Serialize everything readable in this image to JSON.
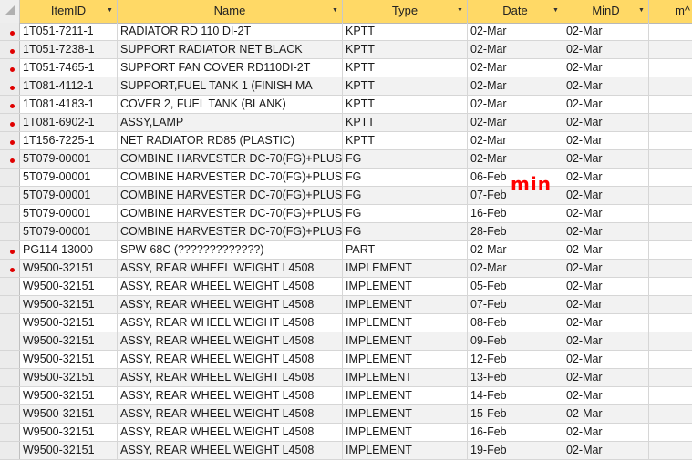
{
  "headers": {
    "item_id": "ItemID",
    "name": "Name",
    "type": "Type",
    "date": "Date",
    "mind": "MinD",
    "extra": "m^"
  },
  "annotation": "min",
  "accent_colors": {
    "header": "#ffd966",
    "dot": "#e00000",
    "annotation": "#ff0000"
  },
  "rows": [
    {
      "dot": true,
      "item_id": "1T051-7211-1",
      "name": "RADIATOR RD 110 DI-2T",
      "type": "KPTT",
      "date": "02-Mar",
      "mind": "02-Mar"
    },
    {
      "dot": true,
      "item_id": "1T051-7238-1",
      "name": "SUPPORT RADIATOR NET BLACK",
      "type": "KPTT",
      "date": "02-Mar",
      "mind": "02-Mar"
    },
    {
      "dot": true,
      "item_id": "1T051-7465-1",
      "name": "SUPPORT FAN COVER RD110DI-2T",
      "type": "KPTT",
      "date": "02-Mar",
      "mind": "02-Mar"
    },
    {
      "dot": true,
      "item_id": "1T081-4112-1",
      "name": "SUPPORT,FUEL TANK 1 (FINISH MA",
      "type": "KPTT",
      "date": "02-Mar",
      "mind": "02-Mar"
    },
    {
      "dot": true,
      "item_id": "1T081-4183-1",
      "name": "COVER 2, FUEL TANK (BLANK)",
      "type": "KPTT",
      "date": "02-Mar",
      "mind": "02-Mar"
    },
    {
      "dot": true,
      "item_id": "1T081-6902-1",
      "name": "ASSY,LAMP",
      "type": "KPTT",
      "date": "02-Mar",
      "mind": "02-Mar"
    },
    {
      "dot": true,
      "item_id": "1T156-7225-1",
      "name": "NET RADIATOR RD85 (PLASTIC)",
      "type": "KPTT",
      "date": "02-Mar",
      "mind": "02-Mar"
    },
    {
      "dot": true,
      "item_id": "5T079-00001",
      "name": "COMBINE HARVESTER DC-70(FG)+PLUS",
      "type": "FG",
      "date": "02-Mar",
      "mind": "02-Mar"
    },
    {
      "dot": false,
      "item_id": "5T079-00001",
      "name": "COMBINE HARVESTER DC-70(FG)+PLUS",
      "type": "FG",
      "date": "06-Feb",
      "mind": "02-Mar"
    },
    {
      "dot": false,
      "item_id": "5T079-00001",
      "name": "COMBINE HARVESTER DC-70(FG)+PLUS",
      "type": "FG",
      "date": "07-Feb",
      "mind": "02-Mar"
    },
    {
      "dot": false,
      "item_id": "5T079-00001",
      "name": "COMBINE HARVESTER DC-70(FG)+PLUS",
      "type": "FG",
      "date": "16-Feb",
      "mind": "02-Mar"
    },
    {
      "dot": false,
      "item_id": "5T079-00001",
      "name": "COMBINE HARVESTER DC-70(FG)+PLUS",
      "type": "FG",
      "date": "28-Feb",
      "mind": "02-Mar"
    },
    {
      "dot": true,
      "item_id": "PG114-13000",
      "name": "SPW-68C (?????????????)",
      "type": "PART",
      "date": "02-Mar",
      "mind": "02-Mar"
    },
    {
      "dot": true,
      "item_id": "W9500-32151",
      "name": "ASSY, REAR WHEEL WEIGHT L4508",
      "type": "IMPLEMENT",
      "date": "02-Mar",
      "mind": "02-Mar"
    },
    {
      "dot": false,
      "item_id": "W9500-32151",
      "name": "ASSY, REAR WHEEL WEIGHT L4508",
      "type": "IMPLEMENT",
      "date": "05-Feb",
      "mind": "02-Mar"
    },
    {
      "dot": false,
      "item_id": "W9500-32151",
      "name": "ASSY, REAR WHEEL WEIGHT L4508",
      "type": "IMPLEMENT",
      "date": "07-Feb",
      "mind": "02-Mar"
    },
    {
      "dot": false,
      "item_id": "W9500-32151",
      "name": "ASSY, REAR WHEEL WEIGHT L4508",
      "type": "IMPLEMENT",
      "date": "08-Feb",
      "mind": "02-Mar"
    },
    {
      "dot": false,
      "item_id": "W9500-32151",
      "name": "ASSY, REAR WHEEL WEIGHT L4508",
      "type": "IMPLEMENT",
      "date": "09-Feb",
      "mind": "02-Mar"
    },
    {
      "dot": false,
      "item_id": "W9500-32151",
      "name": "ASSY, REAR WHEEL WEIGHT L4508",
      "type": "IMPLEMENT",
      "date": "12-Feb",
      "mind": "02-Mar"
    },
    {
      "dot": false,
      "item_id": "W9500-32151",
      "name": "ASSY, REAR WHEEL WEIGHT L4508",
      "type": "IMPLEMENT",
      "date": "13-Feb",
      "mind": "02-Mar"
    },
    {
      "dot": false,
      "item_id": "W9500-32151",
      "name": "ASSY, REAR WHEEL WEIGHT L4508",
      "type": "IMPLEMENT",
      "date": "14-Feb",
      "mind": "02-Mar"
    },
    {
      "dot": false,
      "item_id": "W9500-32151",
      "name": "ASSY, REAR WHEEL WEIGHT L4508",
      "type": "IMPLEMENT",
      "date": "15-Feb",
      "mind": "02-Mar"
    },
    {
      "dot": false,
      "item_id": "W9500-32151",
      "name": "ASSY, REAR WHEEL WEIGHT L4508",
      "type": "IMPLEMENT",
      "date": "16-Feb",
      "mind": "02-Mar"
    },
    {
      "dot": false,
      "item_id": "W9500-32151",
      "name": "ASSY, REAR WHEEL WEIGHT L4508",
      "type": "IMPLEMENT",
      "date": "19-Feb",
      "mind": "02-Mar"
    }
  ]
}
